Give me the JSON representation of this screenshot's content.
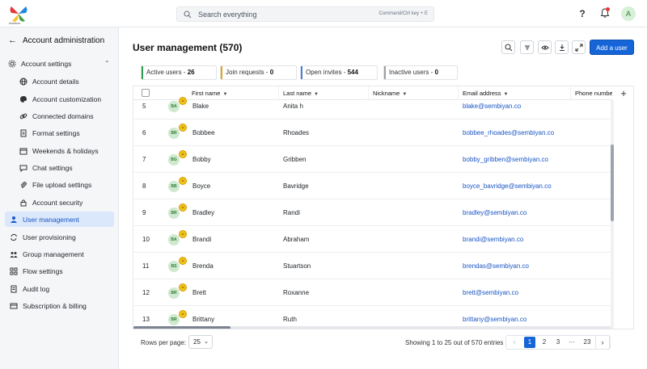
{
  "app": {
    "logo_text": "kissflow"
  },
  "search": {
    "placeholder": "Search everything",
    "shortcut": "Command/Ctrl key + E"
  },
  "header": {
    "help_label": "?",
    "avatar_initial": "A"
  },
  "sidebar": {
    "title": "Account administration",
    "section_label": "Account settings",
    "items": [
      {
        "label": "Account details",
        "icon": "globe-icon"
      },
      {
        "label": "Account customization",
        "icon": "palette-icon"
      },
      {
        "label": "Connected domains",
        "icon": "link-icon"
      },
      {
        "label": "Format settings",
        "icon": "document-icon"
      },
      {
        "label": "Weekends & holidays",
        "icon": "calendar-icon"
      },
      {
        "label": "Chat settings",
        "icon": "chat-icon"
      },
      {
        "label": "File upload settings",
        "icon": "paperclip-icon"
      },
      {
        "label": "Account security",
        "icon": "lock-icon"
      }
    ],
    "top_items": [
      {
        "label": "User management",
        "icon": "user-icon",
        "active": true
      },
      {
        "label": "User provisioning",
        "icon": "sync-icon"
      },
      {
        "label": "Group management",
        "icon": "group-icon"
      },
      {
        "label": "Flow settings",
        "icon": "flow-icon"
      },
      {
        "label": "Audit log",
        "icon": "log-icon"
      },
      {
        "label": "Subscription & billing",
        "icon": "billing-icon"
      }
    ]
  },
  "main": {
    "title": "User management (570)",
    "add_button": "Add a user",
    "stats": [
      {
        "label": "Active users - ",
        "value": "26",
        "color": "#2e9e4f"
      },
      {
        "label": "Join requests - ",
        "value": "0",
        "color": "#e8a21a"
      },
      {
        "label": "Open invites - ",
        "value": "544",
        "color": "#4a7fe0"
      },
      {
        "label": "Inactive users - ",
        "value": "0",
        "color": "#9aa0a6"
      }
    ]
  },
  "table": {
    "columns": [
      "First name",
      "Last name",
      "Nickname",
      "Email address",
      "Phone number"
    ],
    "rows": [
      {
        "num": "5",
        "initials": "BA",
        "first": "Blake",
        "last": "Anita h",
        "email": "blake@sembiyan.co"
      },
      {
        "num": "6",
        "initials": "BR",
        "first": "Bobbee",
        "last": "Rhoades",
        "email": "bobbee_rhoades@sembiyan.co"
      },
      {
        "num": "7",
        "initials": "BG",
        "first": "Bobby",
        "last": "Gribben",
        "email": "bobby_gribben@sembiyan.co"
      },
      {
        "num": "8",
        "initials": "BB",
        "first": "Boyce",
        "last": "Bavridge",
        "email": "boyce_bavridge@sembiyan.co"
      },
      {
        "num": "9",
        "initials": "BR",
        "first": "Bradley",
        "last": "Randi",
        "email": "bradley@sembiyan.co"
      },
      {
        "num": "10",
        "initials": "BA",
        "first": "Brandi",
        "last": "Abraham",
        "email": "brandi@sembiyan.co"
      },
      {
        "num": "11",
        "initials": "BS",
        "first": "Brenda",
        "last": "Stuartson",
        "email": "brendas@sembiyan.co"
      },
      {
        "num": "12",
        "initials": "BR",
        "first": "Brett",
        "last": "Roxanne",
        "email": "brett@sembiyan.co"
      },
      {
        "num": "13",
        "initials": "BR",
        "first": "Brittany",
        "last": "Ruth",
        "email": "brittany@sembiyan.co"
      }
    ]
  },
  "footer": {
    "rows_per_page_label": "Rows per page:",
    "rows_per_page_value": "25",
    "showing_text": "Showing 1 to 25 out of 570 entries",
    "pages": [
      "1",
      "2",
      "3",
      "···",
      "23"
    ],
    "prev": "‹",
    "next": "›"
  }
}
